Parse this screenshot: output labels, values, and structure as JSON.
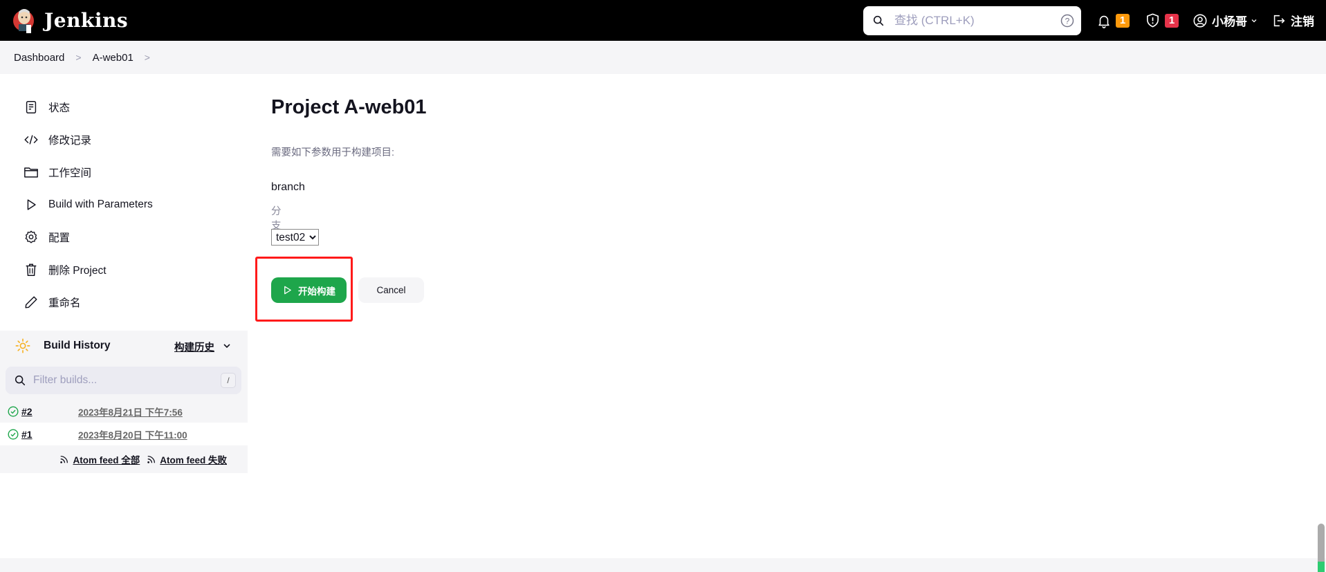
{
  "header": {
    "app_name": "Jenkins",
    "search_placeholder": "查找 (CTRL+K)",
    "notifications_count": "1",
    "security_count": "1",
    "user_name": "小杨哥",
    "logout_label": "注销"
  },
  "breadcrumb": {
    "items": [
      "Dashboard",
      "A-web01"
    ]
  },
  "sidebar": {
    "tasks": [
      {
        "label": "状态",
        "icon": "status-icon"
      },
      {
        "label": "修改记录",
        "icon": "code-icon"
      },
      {
        "label": "工作空间",
        "icon": "folder-icon"
      },
      {
        "label": "Build with Parameters",
        "icon": "play-icon"
      },
      {
        "label": "配置",
        "icon": "gear-icon"
      },
      {
        "label": "删除 Project",
        "icon": "trash-icon"
      },
      {
        "label": "重命名",
        "icon": "pencil-icon"
      }
    ]
  },
  "build_history": {
    "title": "Build History",
    "trend_link": "构建历史",
    "filter_placeholder": "Filter builds...",
    "filter_shortcut": "/",
    "builds": [
      {
        "number": "#2",
        "date": "2023年8月21日 下午7:56",
        "status": "success"
      },
      {
        "number": "#1",
        "date": "2023年8月20日 下午11:00",
        "status": "success"
      }
    ],
    "feeds": [
      "Atom feed 全部",
      "Atom feed 失败"
    ]
  },
  "main": {
    "title": "Project A-web01",
    "description": "需要如下参数用于构建项目:",
    "parameter": {
      "name": "branch",
      "help": "分支",
      "selected": "test02"
    },
    "build_label": "开始构建",
    "cancel_label": "Cancel"
  },
  "colors": {
    "build_button": "#1ea64b",
    "notification_badge": "#fe9a0c",
    "security_badge": "#e6334a",
    "annotation": "#ff1a1a"
  }
}
